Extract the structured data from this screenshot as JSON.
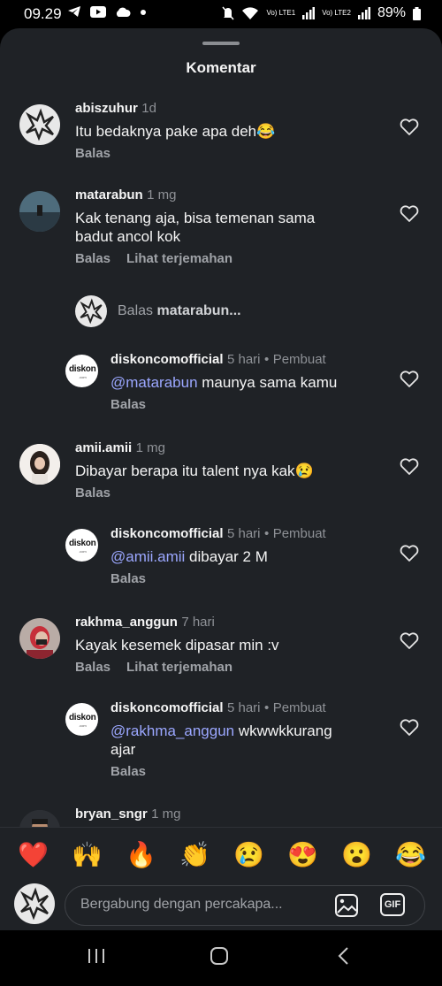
{
  "status_bar": {
    "time": "09.29",
    "battery": "89%",
    "net1": "Vo) LTE1",
    "net2": "Vo) LTE2"
  },
  "sheet": {
    "title": "Komentar"
  },
  "comments": [
    {
      "username": "abiszuhur",
      "time": "1d",
      "text": "Itu bedaknya pake apa deh😂",
      "reply_label": "Balas"
    },
    {
      "username": "matarabun",
      "time": "1 mg",
      "text_line1": "Kak tenang aja, bisa temenan sama",
      "text_line2": "badut ancol kok",
      "reply_label": "Balas",
      "translate_label": "Lihat terjemahan"
    },
    {
      "username": "amii.amii",
      "time": "1 mg",
      "text": "Dibayar berapa itu talent nya kak😢",
      "reply_label": "Balas"
    },
    {
      "username": "rakhma_anggun",
      "time": "7 hari",
      "text": "Kayak kesemek dipasar min :v",
      "reply_label": "Balas",
      "translate_label": "Lihat terjemahan"
    },
    {
      "username": "bryan_sngr",
      "time": "1 mg"
    }
  ],
  "reply_prompt": {
    "prefix": "Balas",
    "target": "matarabun..."
  },
  "replies": [
    {
      "username": "diskoncomofficial",
      "time": "5 hari",
      "badge": "Pembuat",
      "mention": "@matarabun",
      "text": " maunya sama kamu",
      "reply_label": "Balas"
    },
    {
      "username": "diskoncomofficial",
      "time": "5 hari",
      "badge": "Pembuat",
      "mention": "@amii.amii",
      "text": " dibayar 2 M",
      "reply_label": "Balas"
    },
    {
      "username": "diskoncomofficial",
      "time": "5 hari",
      "badge": "Pembuat",
      "mention": "@rakhma_anggun",
      "text": " wkwwkkurang",
      "text_line2": "ajar",
      "reply_label": "Balas"
    }
  ],
  "logo": {
    "text": "diskon",
    "sub": ".com"
  },
  "emoji_bar": [
    "❤️",
    "🙌",
    "🔥",
    "👏",
    "😢",
    "😍",
    "😮",
    "😂"
  ],
  "input": {
    "placeholder": "Bergabung dengan percakapa...",
    "gif_label": "GIF"
  },
  "icons": {
    "heart": "heart-icon",
    "image": "image-icon",
    "gif": "gif-icon",
    "recent": "recent-apps-icon",
    "home": "home-icon",
    "back": "back-icon"
  },
  "colors": {
    "sheet_bg": "#1f2226",
    "mention": "#9ba7ff",
    "muted": "#a0a3a8"
  }
}
